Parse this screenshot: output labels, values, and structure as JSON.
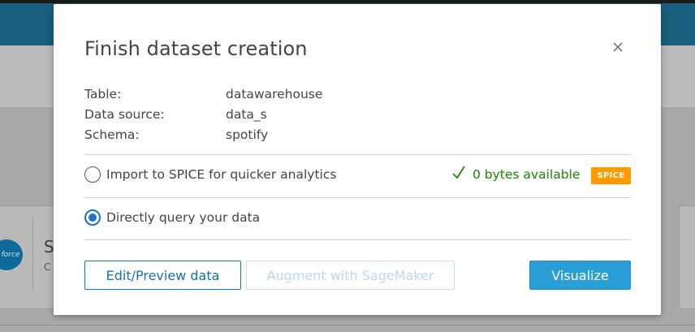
{
  "background": {
    "card_letter": "S",
    "card_sub": "C",
    "card_logo_text": "force"
  },
  "modal": {
    "title": "Finish dataset creation",
    "details": [
      {
        "label": "Table:",
        "value": "datawarehouse"
      },
      {
        "label": "Data source:",
        "value": "data_s"
      },
      {
        "label": "Schema:",
        "value": "spotify"
      }
    ],
    "options": {
      "spice": {
        "label": "Import to SPICE for quicker analytics",
        "checked": false
      },
      "direct": {
        "label": "Directly query your data",
        "checked": true
      }
    },
    "capacity_text": "0 bytes available",
    "spice_badge": "SPICE",
    "buttons": {
      "edit": "Edit/Preview data",
      "augment": "Augment with SageMaker",
      "visualize": "Visualize"
    }
  },
  "colors": {
    "accent": "#2a9ed6",
    "success": "#1d8102",
    "badge": "#ff9900",
    "radio_selected": "#1a73c8"
  },
  "icons": [
    "close-icon",
    "check-icon"
  ]
}
